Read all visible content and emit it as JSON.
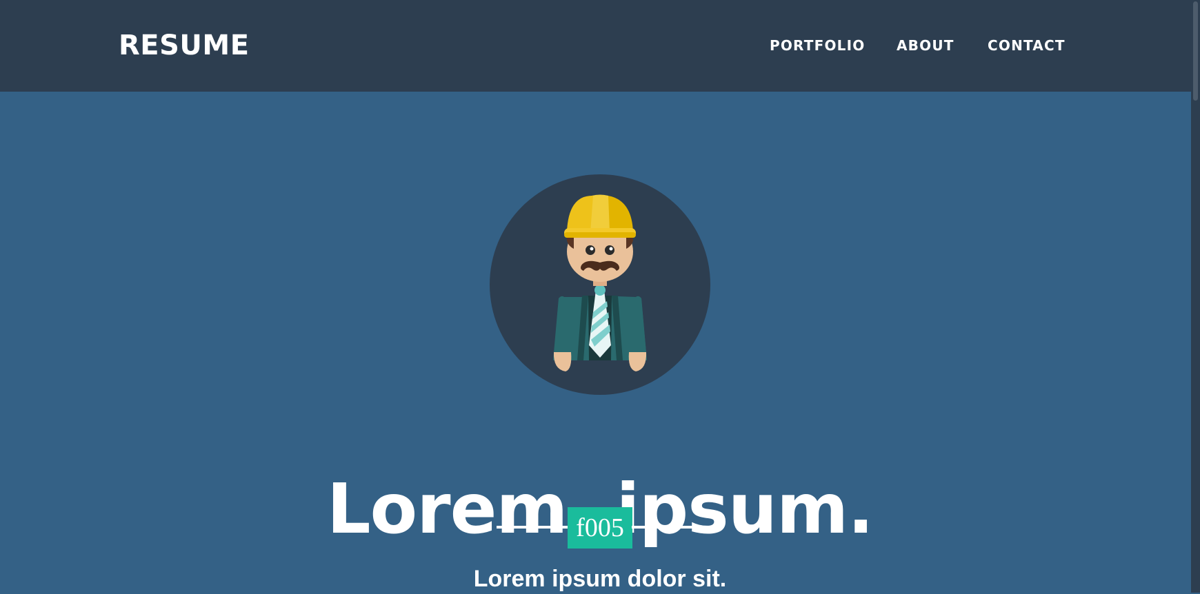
{
  "navbar": {
    "brand": "RESUME",
    "links": [
      {
        "label": "PORTFOLIO"
      },
      {
        "label": "ABOUT"
      },
      {
        "label": "CONTACT"
      }
    ]
  },
  "hero": {
    "avatar_icon": "construction-worker-avatar-icon",
    "title": "Lorem, ipsum.",
    "divider_glyph": "f005",
    "subtitle": "Lorem ipsum dolor sit."
  },
  "colors": {
    "navbar_bg": "#2d3e50",
    "page_bg": "#346186",
    "accent": "#1abc9c",
    "text": "#ffffff"
  }
}
